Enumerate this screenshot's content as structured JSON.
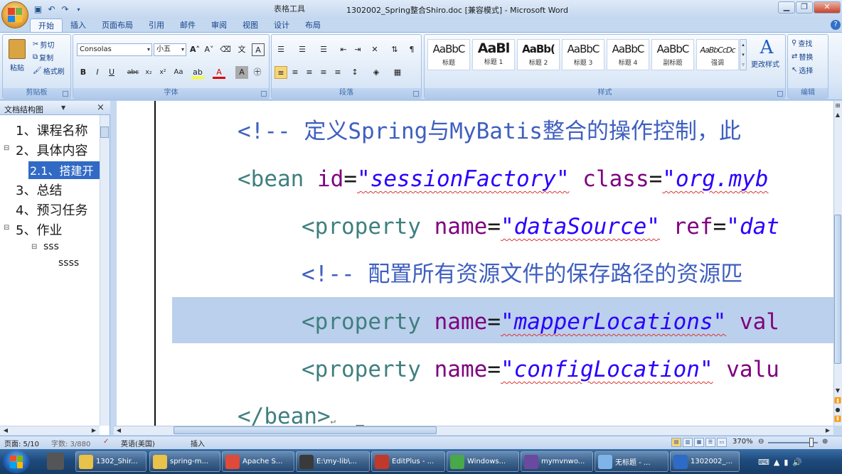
{
  "window": {
    "contextual_tools": "表格工具",
    "title": "1302002_Spring整合Shiro.doc [兼容模式] - Microsoft Word",
    "qat_icons": [
      "save-icon",
      "undo-icon",
      "redo-icon"
    ]
  },
  "tabs": [
    "开始",
    "插入",
    "页面布局",
    "引用",
    "邮件",
    "审阅",
    "视图",
    "设计",
    "布局"
  ],
  "ribbon": {
    "clipboard": {
      "paste": "粘贴",
      "cut": "剪切",
      "copy": "复制",
      "format_painter": "格式刷",
      "label": "剪贴板"
    },
    "font": {
      "name": "Consolas",
      "size": "小五",
      "label": "字体"
    },
    "paragraph": {
      "label": "段落"
    },
    "styles": {
      "label": "样式",
      "change_styles": "更改样式",
      "items": [
        {
          "sample": "AaBbC",
          "name": "标题"
        },
        {
          "sample": "AaBl",
          "name": "标题 1"
        },
        {
          "sample": "AaBb(",
          "name": "标题 2"
        },
        {
          "sample": "AaBbC",
          "name": "标题 3"
        },
        {
          "sample": "AaBbC",
          "name": "标题 4"
        },
        {
          "sample": "AaBbC",
          "name": "副标题"
        },
        {
          "sample": "AaBbCcDc",
          "name": "强调"
        }
      ]
    },
    "editing": {
      "find": "查找",
      "replace": "替换",
      "select": "选择",
      "label": "编辑"
    }
  },
  "nav": {
    "title": "文档结构图",
    "items": [
      {
        "label": "1、课程名称"
      },
      {
        "label": "2、具体内容"
      },
      {
        "label": "2.1、搭建开"
      },
      {
        "label": "3、总结"
      },
      {
        "label": "4、预习任务"
      },
      {
        "label": "5、作业"
      },
      {
        "label": "sss"
      },
      {
        "label": "ssss"
      }
    ]
  },
  "code": {
    "line1": {
      "comment": "<!-- 定义Spring与MyBatis整合的操作控制，此"
    },
    "line2": {
      "tag": "<bean",
      "attr1": " id",
      "val1": "\"sessionFactory\"",
      "attr2": " class",
      "val2": "\"org.myb"
    },
    "line3": {
      "tag": "<property",
      "attr1": " name",
      "val1": "\"dataSource\"",
      "attr2": " ref",
      "val2": "\"dat"
    },
    "line4": {
      "comment": "<!-- 配置所有资源文件的保存路径的资源匹"
    },
    "line5": {
      "tag": "<property",
      "attr1": " name",
      "val1": "\"mapperLocations\"",
      "attr2": " val"
    },
    "line6": {
      "tag": "<property",
      "attr1": " name",
      "val1": "\"configLocation\"",
      "attr2": " valu"
    },
    "line7": {
      "tag": "</bean>",
      "mark": "↵"
    },
    "eq": "="
  },
  "status": {
    "page": "页面: 5/10",
    "words": "字数: 3/880",
    "language": "英语(美国)",
    "mode": "插入",
    "zoom": "370%"
  },
  "taskbar": [
    {
      "label": "1302_Shir...",
      "color": "#e8c24a"
    },
    {
      "label": "spring-m...",
      "color": "#e8c24a"
    },
    {
      "label": "Apache S...",
      "color": "#e04a3a"
    },
    {
      "label": "E:\\my-lib\\...",
      "color": "#3a3a3a"
    },
    {
      "label": "EditPlus - ...",
      "color": "#c0392b"
    },
    {
      "label": "Windows...",
      "color": "#49a84a"
    },
    {
      "label": "mymvnwo...",
      "color": "#6a4aa0"
    },
    {
      "label": "无标题 - ...",
      "color": "#7fb4e8"
    },
    {
      "label": "1302002_...",
      "color": "#2e6bc6"
    }
  ],
  "colors": {
    "accent": "#316ac5",
    "comment": "#3f5fbf",
    "tag": "#3f7f7f",
    "attr": "#7f007f",
    "value": "#2a00ff",
    "highlight": "#bbd0ec"
  }
}
